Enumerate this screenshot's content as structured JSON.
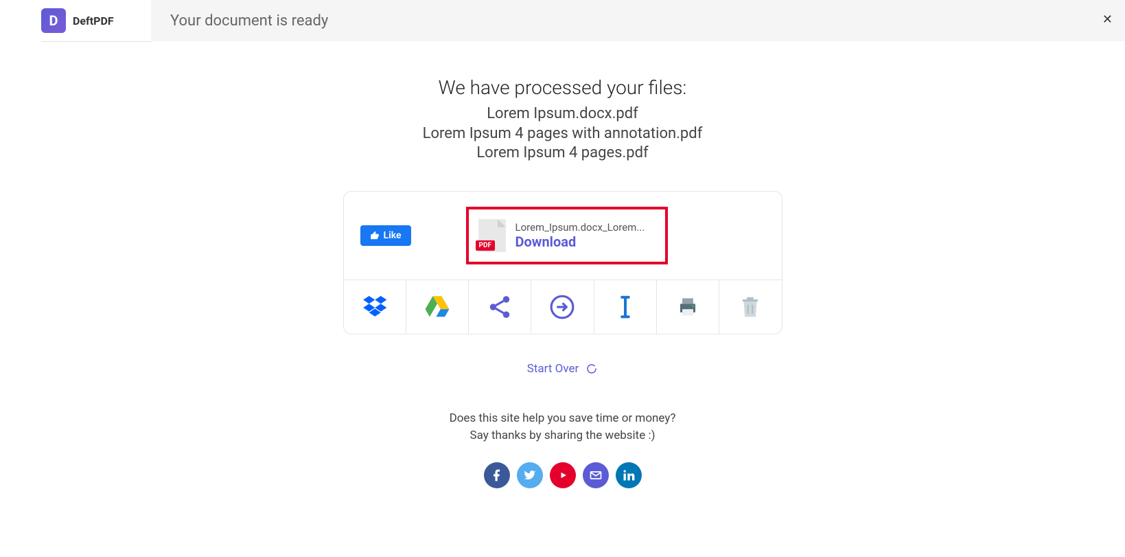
{
  "logo": {
    "letter": "D",
    "name": "DeftPDF"
  },
  "header": {
    "title": "Your document is ready"
  },
  "main": {
    "heading": "We have processed your files:",
    "files": [
      "Lorem Ipsum.docx.pdf",
      "Lorem Ipsum 4 pages with annotation.pdf",
      "Lorem Ipsum 4 pages.pdf"
    ]
  },
  "like": {
    "label": "Like"
  },
  "download": {
    "filename": "Lorem_Ipsum.docx_Lorem...",
    "badge": "PDF",
    "label": "Download"
  },
  "actions": {
    "dropbox": "dropbox-icon",
    "gdrive": "gdrive-icon",
    "share": "share-icon",
    "next": "arrow-circle-icon",
    "rename": "text-cursor-icon",
    "print": "printer-icon",
    "delete": "trash-icon"
  },
  "startOver": {
    "label": "Start Over"
  },
  "prompt": {
    "line1": "Does this site help you save time or money?",
    "line2": "Say thanks by sharing the website :)"
  },
  "social": [
    "facebook",
    "twitter",
    "youtube",
    "email",
    "linkedin"
  ]
}
